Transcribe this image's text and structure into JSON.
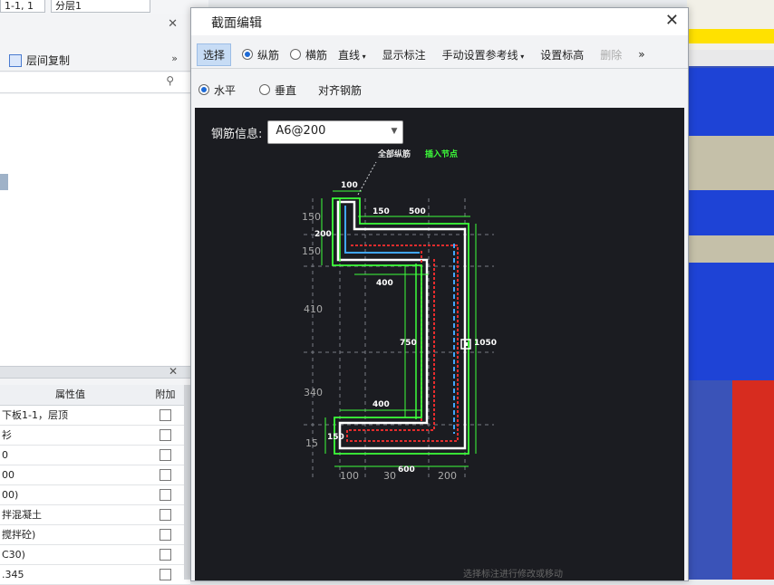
{
  "topbar": {
    "select1": "1-1, 1",
    "select2": "分层1"
  },
  "left_panel": {
    "copy_label": "层间复制",
    "prop_header": {
      "value_col": "属性值",
      "extra_col": "附加"
    },
    "prop_rows": [
      {
        "value": "下板1-1，层顶"
      },
      {
        "value": "衫"
      },
      {
        "value": "0"
      },
      {
        "value": "00"
      },
      {
        "value": "00)"
      },
      {
        "value": "拌混凝土"
      },
      {
        "value": "搅拌砼)"
      },
      {
        "value": "C30)"
      },
      {
        "value": ".345"
      }
    ]
  },
  "dialog": {
    "title": "截面编辑",
    "toolbar1": {
      "select": "选择",
      "longitudinal": "纵筋",
      "transverse": "横筋",
      "line": "直线",
      "show_annotation": "显示标注",
      "manual_ref_line": "手动设置参考线",
      "set_elevation": "设置标高",
      "delete": "删除",
      "more": "»"
    },
    "toolbar2": {
      "horizontal": "水平",
      "vertical": "垂直",
      "align": "对齐钢筋"
    },
    "rebar_info_label": "钢筋信息:",
    "rebar_info_value": "A6@200",
    "annotations": {
      "all_longitudinal": "全部纵筋",
      "insert_node": "插入节点",
      "d100_top": "100",
      "d150_left_top": "150",
      "d200_left": "200",
      "d150_left_mid": "150",
      "d150_inner": "150",
      "d500": "500",
      "d400_top": "400",
      "d410": "410",
      "d750": "750",
      "d1050": "1050",
      "d340": "340",
      "d400_bottom": "400",
      "d150_bottom": "150",
      "d150_left_bottom": "15",
      "d600": "600",
      "d100_bottom": "100",
      "d300_bottom": "30",
      "d200_bottom": "200"
    },
    "status_hint": "选择标注进行修改或移动"
  },
  "colors": {
    "canvas_bg": "#1b1c21",
    "green": "#3dff3a",
    "red": "#ff2f2f",
    "blue": "#41a6ff",
    "white_outline": "#ffffff"
  }
}
